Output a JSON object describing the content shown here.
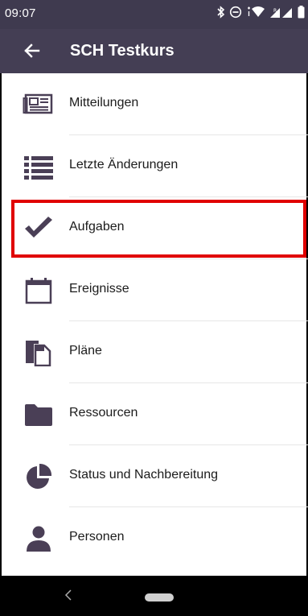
{
  "status_bar": {
    "time": "09:07",
    "icons": [
      "bluetooth-icon",
      "do-not-disturb-icon",
      "wifi-icon",
      "signal-icon",
      "battery-icon"
    ]
  },
  "app_bar": {
    "back_icon": "arrow-left-icon",
    "title": "SCH Testkurs",
    "background": "#443e54"
  },
  "menu": {
    "icon_color": "#4a3f56",
    "items": [
      {
        "label": "Mitteilungen",
        "icon": "newspaper-icon"
      },
      {
        "label": "Letzte Änderungen",
        "icon": "list-icon"
      },
      {
        "label": "Aufgaben",
        "icon": "checkmark-icon",
        "highlighted": true
      },
      {
        "label": "Ereignisse",
        "icon": "calendar-icon"
      },
      {
        "label": "Pläne",
        "icon": "documents-icon"
      },
      {
        "label": "Ressourcen",
        "icon": "folder-icon"
      },
      {
        "label": "Status und Nachbereitung",
        "icon": "pie-chart-icon"
      },
      {
        "label": "Personen",
        "icon": "person-icon"
      }
    ]
  },
  "highlight_color": "#e00000",
  "nav_bar": {
    "back_icon": "nav-back-icon",
    "home_icon": "home-pill-icon"
  }
}
